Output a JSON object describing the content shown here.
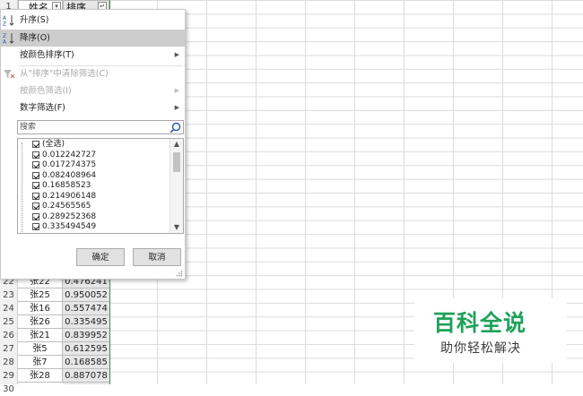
{
  "header": {
    "row_number": "1",
    "col_a_title": "姓名",
    "col_b_title": "排序",
    "filter_glyph_a": "▾",
    "filter_glyph_b": "↵"
  },
  "rows": [
    {
      "num": "22",
      "name": "张22",
      "value": "0.476241"
    },
    {
      "num": "23",
      "name": "张25",
      "value": "0.950052"
    },
    {
      "num": "24",
      "name": "张16",
      "value": "0.557474"
    },
    {
      "num": "25",
      "name": "张26",
      "value": "0.335495"
    },
    {
      "num": "26",
      "name": "张21",
      "value": "0.839952"
    },
    {
      "num": "27",
      "name": "张5",
      "value": "0.612595"
    },
    {
      "num": "28",
      "name": "张7",
      "value": "0.168585"
    },
    {
      "num": "29",
      "name": "张28",
      "value": "0.887078"
    },
    {
      "num": "30",
      "name": "",
      "value": ""
    }
  ],
  "menu": {
    "sort_asc": {
      "label": "升序(S)",
      "icon": "sort-ascending-icon"
    },
    "sort_desc": {
      "label": "降序(O)",
      "icon": "sort-descending-icon"
    },
    "sort_by_color": {
      "label": "按颜色排序(T)"
    },
    "clear_filter": {
      "label": "从\"排序\"中清除筛选(C)",
      "icon": "clear-filter-icon"
    },
    "filter_by_color": {
      "label": "按颜色筛选(I)"
    },
    "number_filters": {
      "label": "数字筛选(F)"
    }
  },
  "search": {
    "placeholder": "搜索"
  },
  "filter_list": [
    {
      "label": "(全选)",
      "checked": true
    },
    {
      "label": "0.012242727",
      "checked": true
    },
    {
      "label": "0.017274375",
      "checked": true
    },
    {
      "label": "0.082408964",
      "checked": true
    },
    {
      "label": "0.16858523",
      "checked": true
    },
    {
      "label": "0.214906148",
      "checked": true
    },
    {
      "label": "0.24565565",
      "checked": true
    },
    {
      "label": "0.289252368",
      "checked": true
    },
    {
      "label": "0.335494549",
      "checked": true
    }
  ],
  "buttons": {
    "ok": "确定",
    "cancel": "取消"
  },
  "watermark": {
    "title": "百科全说",
    "subtitle": "助你轻松解决"
  },
  "colors": {
    "selected_item": "#cdcdcd",
    "watermark_green": "#1fa15a",
    "column_selected": "#e6e6e6"
  }
}
